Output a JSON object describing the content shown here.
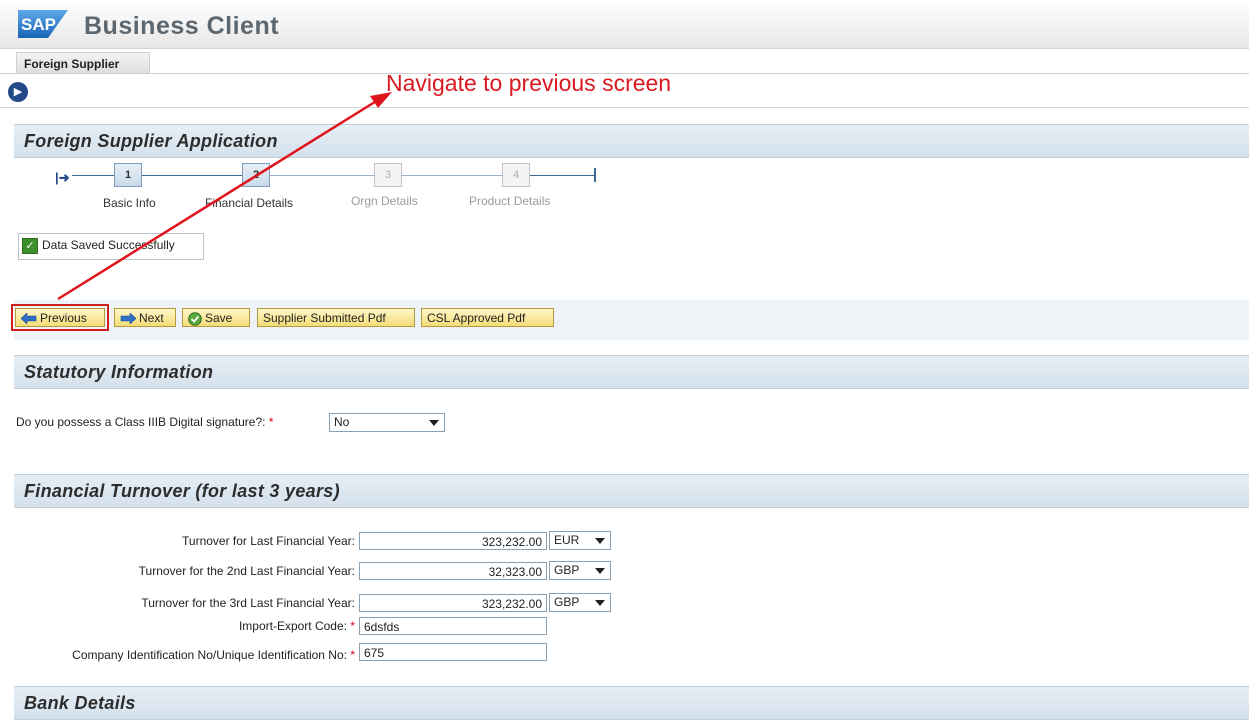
{
  "header": {
    "logo_text": "SAP",
    "app_title": "Business Client"
  },
  "tab": {
    "label": "Foreign Supplier"
  },
  "annotation": {
    "text": "Navigate to previous screen"
  },
  "application": {
    "title": "Foreign Supplier Application"
  },
  "roadmap": {
    "steps": [
      {
        "number": "1",
        "label": "Basic Info"
      },
      {
        "number": "2",
        "label": "Financial Details"
      },
      {
        "number": "3",
        "label": "Orgn Details"
      },
      {
        "number": "4",
        "label": "Product Details"
      }
    ]
  },
  "message": {
    "text": "Data Saved Successfully"
  },
  "toolbar": {
    "previous_label": "Previous",
    "next_label": "Next",
    "save_label": "Save",
    "supplier_pdf_label": "Supplier Submitted Pdf",
    "csl_pdf_label": "CSL Approved Pdf"
  },
  "statutory": {
    "title": "Statutory Information",
    "signature_label": "Do you possess a Class IIIB Digital signature?:",
    "signature_value": "No"
  },
  "turnover": {
    "title": "Financial Turnover (for last 3 years)",
    "rows": [
      {
        "label": "Turnover for Last Financial Year:",
        "value": "323,232.00",
        "currency": "EUR"
      },
      {
        "label": "Turnover for the 2nd Last Financial Year:",
        "value": "32,323.00",
        "currency": "GBP"
      },
      {
        "label": "Turnover for the 3rd Last Financial Year:",
        "value": "323,232.00",
        "currency": "GBP"
      }
    ],
    "iec_label": "Import-Export Code:",
    "iec_value": "6dsfds",
    "company_id_label": "Company Identification No/Unique Identification No:",
    "company_id_value": "675"
  },
  "bank": {
    "title": "Bank Details"
  },
  "colors": {
    "accent": "#234a86",
    "annotation": "#d8191f",
    "button": "#f4dc78"
  }
}
